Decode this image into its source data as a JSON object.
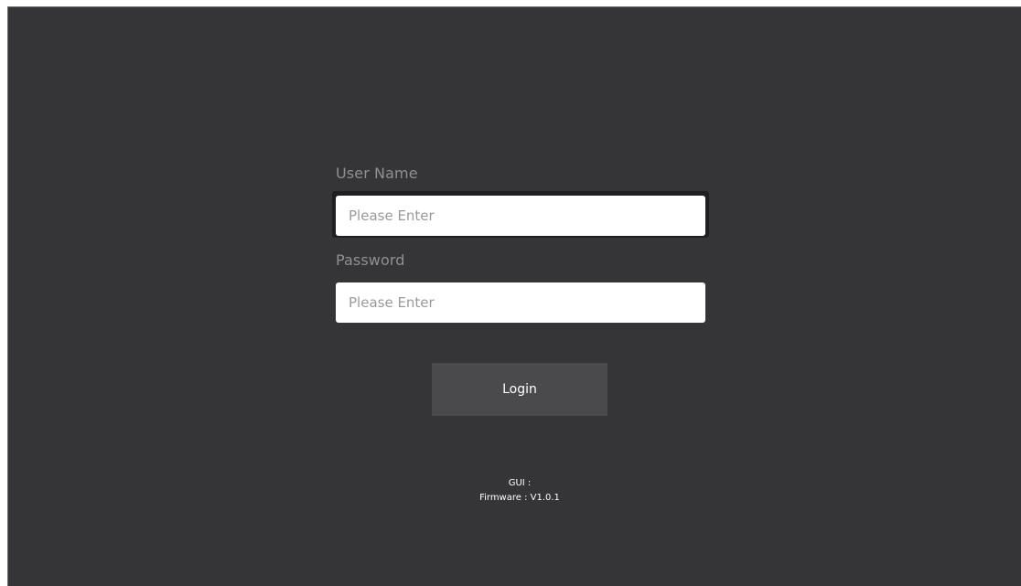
{
  "login": {
    "username_label": "User Name",
    "username_placeholder": "Please Enter",
    "username_value": "",
    "password_label": "Password",
    "password_placeholder": "Please Enter",
    "password_value": "",
    "login_button_label": "Login"
  },
  "footer": {
    "gui_text": "GUI :",
    "firmware_text": "Firmware : V1.0.1"
  },
  "colors": {
    "background": "#353538",
    "input_background": "#ffffff",
    "button_background": "#4a4a4c",
    "label_color": "#8f8f94"
  }
}
